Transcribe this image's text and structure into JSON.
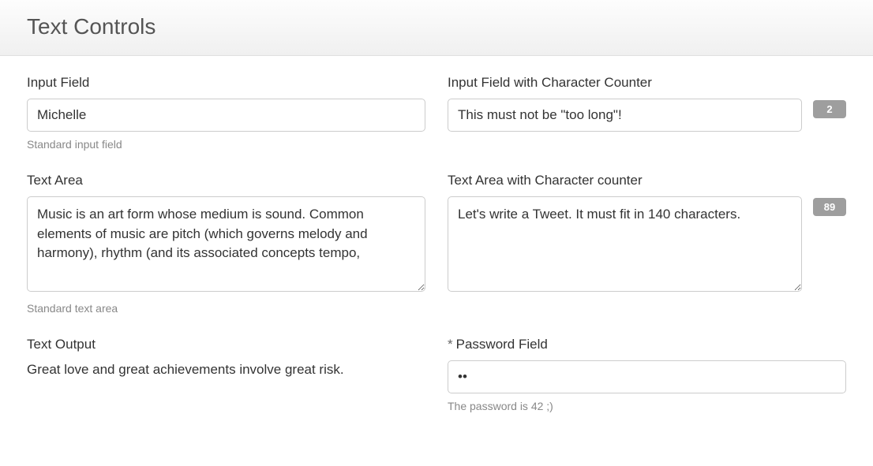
{
  "header": {
    "title": "Text Controls"
  },
  "left": {
    "input": {
      "label": "Input Field",
      "value": "Michelle",
      "hint": "Standard input field"
    },
    "textarea": {
      "label": "Text Area",
      "value": "Music is an art form whose medium is sound. Common elements of music are pitch (which governs melody and harmony), rhythm (and its associated concepts tempo,",
      "hint": "Standard text area"
    },
    "output": {
      "label": "Text Output",
      "value": "Great love and great achievements involve great risk."
    }
  },
  "right": {
    "input_counter": {
      "label": "Input Field with Character Counter",
      "value": "This must not be \"too long\"!",
      "count": "2"
    },
    "textarea_counter": {
      "label": "Text Area with Character counter",
      "value": "Let's write a Tweet. It must fit in 140 characters.",
      "count": "89"
    },
    "password": {
      "label": "Password Field",
      "required_mark": "*",
      "value": "42",
      "hint": "The password is 42 ;)"
    }
  }
}
